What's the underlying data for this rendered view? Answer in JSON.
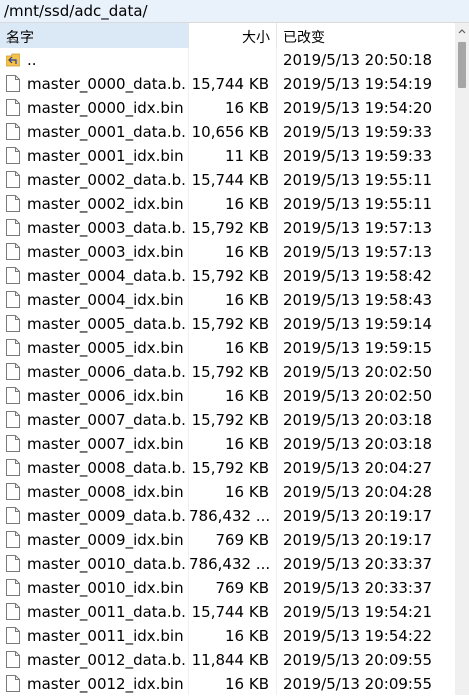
{
  "path": "/mnt/ssd/adc_data/",
  "columns": {
    "name": "名字",
    "size": "大小",
    "date": "已改变"
  },
  "parent_row": {
    "name": "..",
    "size": "",
    "date": "2019/5/13 20:50:18"
  },
  "files": [
    {
      "name": "master_0000_data.b...",
      "size": "15,744 KB",
      "date": "2019/5/13 19:54:19"
    },
    {
      "name": "master_0000_idx.bin",
      "size": "16 KB",
      "date": "2019/5/13 19:54:20"
    },
    {
      "name": "master_0001_data.b...",
      "size": "10,656 KB",
      "date": "2019/5/13 19:59:33"
    },
    {
      "name": "master_0001_idx.bin",
      "size": "11 KB",
      "date": "2019/5/13 19:59:33"
    },
    {
      "name": "master_0002_data.b...",
      "size": "15,744 KB",
      "date": "2019/5/13 19:55:11"
    },
    {
      "name": "master_0002_idx.bin",
      "size": "16 KB",
      "date": "2019/5/13 19:55:11"
    },
    {
      "name": "master_0003_data.b...",
      "size": "15,792 KB",
      "date": "2019/5/13 19:57:13"
    },
    {
      "name": "master_0003_idx.bin",
      "size": "16 KB",
      "date": "2019/5/13 19:57:13"
    },
    {
      "name": "master_0004_data.b...",
      "size": "15,792 KB",
      "date": "2019/5/13 19:58:42"
    },
    {
      "name": "master_0004_idx.bin",
      "size": "16 KB",
      "date": "2019/5/13 19:58:43"
    },
    {
      "name": "master_0005_data.b...",
      "size": "15,792 KB",
      "date": "2019/5/13 19:59:14"
    },
    {
      "name": "master_0005_idx.bin",
      "size": "16 KB",
      "date": "2019/5/13 19:59:15"
    },
    {
      "name": "master_0006_data.b...",
      "size": "15,792 KB",
      "date": "2019/5/13 20:02:50"
    },
    {
      "name": "master_0006_idx.bin",
      "size": "16 KB",
      "date": "2019/5/13 20:02:50"
    },
    {
      "name": "master_0007_data.b...",
      "size": "15,792 KB",
      "date": "2019/5/13 20:03:18"
    },
    {
      "name": "master_0007_idx.bin",
      "size": "16 KB",
      "date": "2019/5/13 20:03:18"
    },
    {
      "name": "master_0008_data.b...",
      "size": "15,792 KB",
      "date": "2019/5/13 20:04:27"
    },
    {
      "name": "master_0008_idx.bin",
      "size": "16 KB",
      "date": "2019/5/13 20:04:28"
    },
    {
      "name": "master_0009_data.b...",
      "size": "786,432 ...",
      "date": "2019/5/13 20:19:17"
    },
    {
      "name": "master_0009_idx.bin",
      "size": "769 KB",
      "date": "2019/5/13 20:19:17"
    },
    {
      "name": "master_0010_data.b...",
      "size": "786,432 ...",
      "date": "2019/5/13 20:33:37"
    },
    {
      "name": "master_0010_idx.bin",
      "size": "769 KB",
      "date": "2019/5/13 20:33:37"
    },
    {
      "name": "master_0011_data.b...",
      "size": "15,744 KB",
      "date": "2019/5/13 19:54:21"
    },
    {
      "name": "master_0011_idx.bin",
      "size": "16 KB",
      "date": "2019/5/13 19:54:22"
    },
    {
      "name": "master_0012_data.b...",
      "size": "11,844 KB",
      "date": "2019/5/13 20:09:55"
    },
    {
      "name": "master_0012_idx.bin",
      "size": "16 KB",
      "date": "2019/5/13 20:09:55"
    }
  ],
  "icons": {
    "parent": "parent-folder-icon",
    "file": "file-icon",
    "sort": "sort-ascending-icon"
  },
  "colors": {
    "pathbar_bg": "#e9f1fb",
    "selected_header": "#dbe9f7",
    "folder": "#f2c14e"
  }
}
